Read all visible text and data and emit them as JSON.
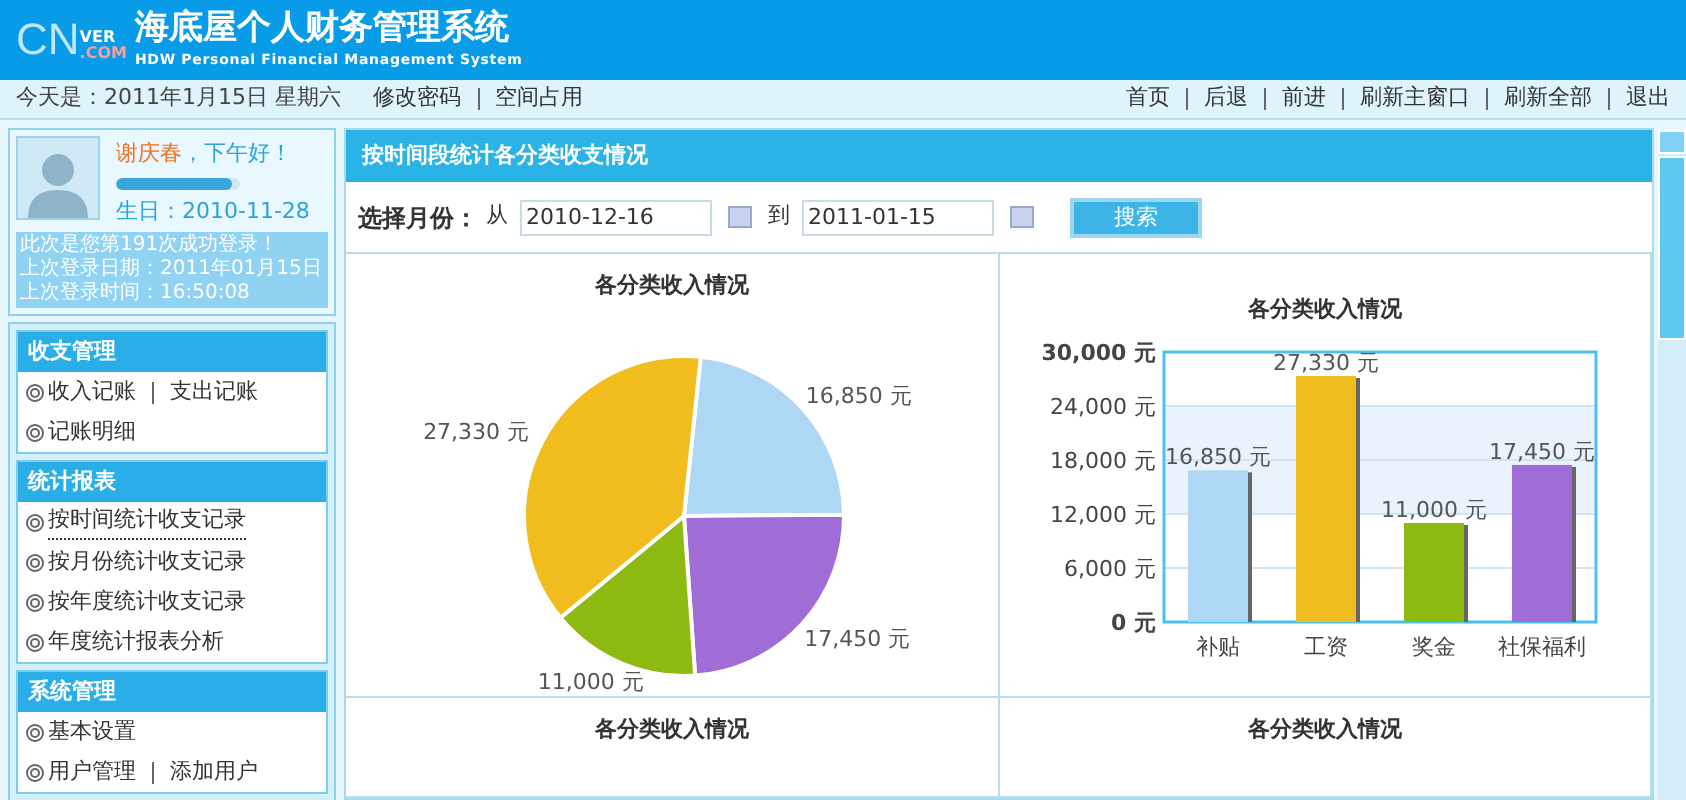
{
  "header": {
    "logo": {
      "main": "CN",
      "sub": "VER",
      "domain": ".COM"
    },
    "title": "海底屋个人财务管理系统",
    "subtitle": "HDW Personal Financial Management System"
  },
  "toolbar": {
    "today": "今天是：2011年1月15日 星期六",
    "left_links": [
      "修改密码",
      "空间占用"
    ],
    "right_links": [
      "首页",
      "后退",
      "前进",
      "刷新主窗口",
      "刷新全部",
      "退出"
    ]
  },
  "user": {
    "name": "谢庆春",
    "greeting": "，下午好！",
    "space": {
      "level": 0.93
    },
    "birthday": "生日：2010-11-28",
    "login_info": [
      "此次是您第191次成功登录！",
      "上次登录日期：2011年01月15日",
      "上次登录时间：16:50:08"
    ]
  },
  "menus": [
    {
      "title": "收支管理",
      "items": [
        {
          "links": [
            "收入记账",
            "支出记账"
          ],
          "selected": false
        },
        {
          "links": [
            "记账明细"
          ],
          "selected": false
        }
      ]
    },
    {
      "title": "统计报表",
      "items": [
        {
          "links": [
            "按时间统计收支记录"
          ],
          "selected": true
        },
        {
          "links": [
            "按月份统计收支记录"
          ],
          "selected": false
        },
        {
          "links": [
            "按年度统计收支记录"
          ],
          "selected": false
        },
        {
          "links": [
            "年度统计报表分析"
          ],
          "selected": false
        }
      ]
    },
    {
      "title": "系统管理",
      "items": [
        {
          "links": [
            "基本设置"
          ],
          "selected": false
        },
        {
          "links": [
            "用户管理",
            "添加用户"
          ],
          "selected": false
        }
      ]
    }
  ],
  "panel": {
    "title": "按时间段统计各分类收支情况",
    "filter": {
      "label": "选择月份：",
      "from_label": "从",
      "from": "2010-12-16",
      "to_label": "到",
      "to": "2011-01-15",
      "button": "搜索"
    }
  },
  "charts": [
    {
      "chart_data": {
        "type": "pie",
        "title": "各分类收入情况",
        "values": [
          16850,
          17450,
          11000,
          27330
        ],
        "value_labels": [
          "16,850 元",
          "17,450 元",
          "11,000 元",
          "27,330 元"
        ]
      }
    },
    {
      "chart_data": {
        "type": "bar",
        "title": "各分类收入情况",
        "categories": [
          "补贴",
          "工资",
          "奖金",
          "社保福利"
        ],
        "values": [
          16850,
          27330,
          11000,
          17450
        ],
        "value_labels": [
          "16,850 元",
          "27,330 元",
          "11,000 元",
          "17,450 元"
        ],
        "ylim": [
          0,
          30000
        ],
        "grid": true,
        "yticks": [
          {
            "value": 0,
            "label": "0 元"
          },
          {
            "value": 6000,
            "label": "6,000 元"
          },
          {
            "value": 12000,
            "label": "12,000 元"
          },
          {
            "value": 18000,
            "label": "18,000 元"
          },
          {
            "value": 24000,
            "label": "24,000 元"
          },
          {
            "value": 30000,
            "label": "30,000 元"
          }
        ]
      }
    },
    {
      "title": "各分类收入情况"
    },
    {
      "title": "各分类收入情况"
    }
  ]
}
